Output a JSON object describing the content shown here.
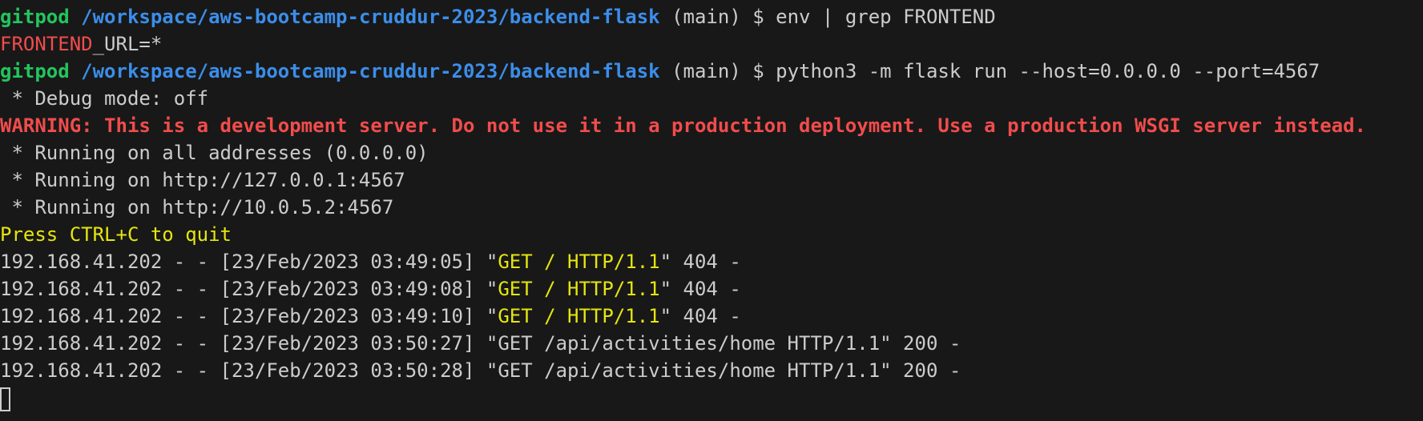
{
  "prompt1": {
    "user": "gitpod",
    "path": "/workspace/aws-bootcamp-cruddur-2023/backend-flask",
    "branch_and_symbol": " (main) $ ",
    "command": "env | grep FRONTEND"
  },
  "env_output": {
    "highlight": "FRONTEND",
    "rest": "_URL=*"
  },
  "prompt2": {
    "user": "gitpod",
    "path": "/workspace/aws-bootcamp-cruddur-2023/backend-flask",
    "branch_and_symbol": " (main) $ ",
    "command": "python3 -m flask run --host=0.0.0.0 --port=4567"
  },
  "server_output": {
    "debug": " * Debug mode: off",
    "warning": "WARNING: This is a development server. Do not use it in a production deployment. Use a production WSGI server instead.",
    "running_all": " * Running on all addresses (0.0.0.0)",
    "running_local": " * Running on http://127.0.0.1:4567",
    "running_net": " * Running on http://10.0.5.2:4567",
    "quit_hint": "Press CTRL+C to quit"
  },
  "logs": [
    {
      "prefix": "192.168.41.202 - - [23/Feb/2023 03:49:05] \"",
      "request": "GET / HTTP/1.1",
      "suffix": "\" 404 -",
      "highlight": true
    },
    {
      "prefix": "192.168.41.202 - - [23/Feb/2023 03:49:08] \"",
      "request": "GET / HTTP/1.1",
      "suffix": "\" 404 -",
      "highlight": true
    },
    {
      "prefix": "192.168.41.202 - - [23/Feb/2023 03:49:10] \"",
      "request": "GET / HTTP/1.1",
      "suffix": "\" 404 -",
      "highlight": true
    },
    {
      "prefix": "192.168.41.202 - - [23/Feb/2023 03:50:27] \"",
      "request": "GET /api/activities/home HTTP/1.1",
      "suffix": "\" 200 -",
      "highlight": false
    },
    {
      "prefix": "192.168.41.202 - - [23/Feb/2023 03:50:28] \"",
      "request": "GET /api/activities/home HTTP/1.1",
      "suffix": "\" 200 -",
      "highlight": false
    }
  ],
  "colors": {
    "background": "#181818",
    "prompt_user": "#23c55e",
    "prompt_path": "#3b8eea",
    "warning": "#f14c4c",
    "highlight": "#e5e510",
    "text": "#cccccc"
  }
}
